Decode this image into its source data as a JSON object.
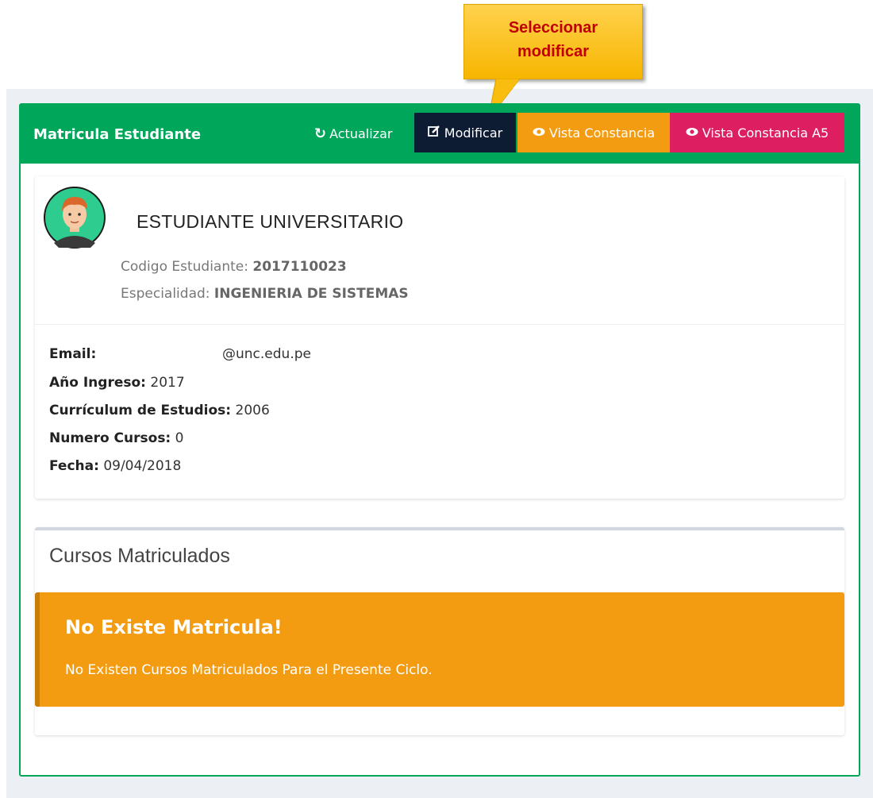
{
  "callout": {
    "line1": "Seleccionar",
    "line2": "modificar"
  },
  "box": {
    "title": "Matricula Estudiante",
    "buttons": {
      "refresh": "Actualizar",
      "modify": "Modificar",
      "constancia": "Vista Constancia",
      "constancia_a5": "Vista Constancia A5"
    }
  },
  "student": {
    "name": "ESTUDIANTE UNIVERSITARIO",
    "code_label": "Codigo Estudiante:",
    "code": "2017110023",
    "specialty_label": "Especialidad:",
    "specialty": "INGENIERIA DE SISTEMAS",
    "email_label": "Email:",
    "email": "@unc.edu.pe",
    "year_label": "Año Ingreso:",
    "year": "2017",
    "curriculum_label": "Currículum de Estudios:",
    "curriculum": "2006",
    "courses_label": "Numero Cursos:",
    "courses": "0",
    "date_label": "Fecha:",
    "date": "09/04/2018"
  },
  "courses_section": {
    "title": "Cursos Matriculados",
    "alert_title": "No Existe Matricula!",
    "alert_text": "No Existen Cursos Matriculados Para el Presente Ciclo."
  },
  "icons": {
    "refresh": "refresh-icon",
    "modify": "edit-icon",
    "view": "eye-icon",
    "avatar": "student-avatar"
  },
  "colors": {
    "header": "#00a65a",
    "modify_button": "#0d1b33",
    "constancia_button": "#f39c12",
    "constancia_a5_button": "#dd1f62",
    "alert": "#f39c12",
    "callout_text": "#c00000"
  }
}
